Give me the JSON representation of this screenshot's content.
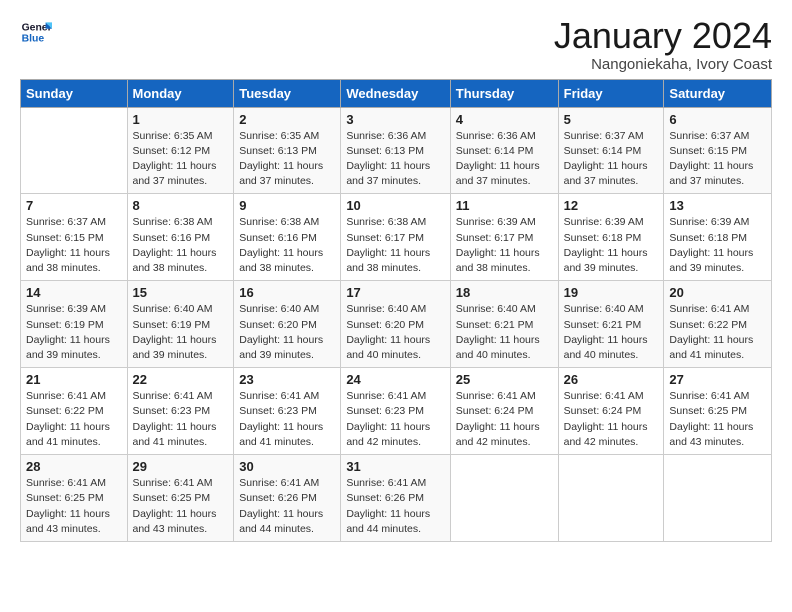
{
  "logo": {
    "line1": "General",
    "line2": "Blue"
  },
  "title": "January 2024",
  "subtitle": "Nangoniekaha, Ivory Coast",
  "days_header": [
    "Sunday",
    "Monday",
    "Tuesday",
    "Wednesday",
    "Thursday",
    "Friday",
    "Saturday"
  ],
  "weeks": [
    [
      {
        "day": "",
        "info": ""
      },
      {
        "day": "1",
        "info": "Sunrise: 6:35 AM\nSunset: 6:12 PM\nDaylight: 11 hours\nand 37 minutes."
      },
      {
        "day": "2",
        "info": "Sunrise: 6:35 AM\nSunset: 6:13 PM\nDaylight: 11 hours\nand 37 minutes."
      },
      {
        "day": "3",
        "info": "Sunrise: 6:36 AM\nSunset: 6:13 PM\nDaylight: 11 hours\nand 37 minutes."
      },
      {
        "day": "4",
        "info": "Sunrise: 6:36 AM\nSunset: 6:14 PM\nDaylight: 11 hours\nand 37 minutes."
      },
      {
        "day": "5",
        "info": "Sunrise: 6:37 AM\nSunset: 6:14 PM\nDaylight: 11 hours\nand 37 minutes."
      },
      {
        "day": "6",
        "info": "Sunrise: 6:37 AM\nSunset: 6:15 PM\nDaylight: 11 hours\nand 37 minutes."
      }
    ],
    [
      {
        "day": "7",
        "info": "Sunrise: 6:37 AM\nSunset: 6:15 PM\nDaylight: 11 hours\nand 38 minutes."
      },
      {
        "day": "8",
        "info": "Sunrise: 6:38 AM\nSunset: 6:16 PM\nDaylight: 11 hours\nand 38 minutes."
      },
      {
        "day": "9",
        "info": "Sunrise: 6:38 AM\nSunset: 6:16 PM\nDaylight: 11 hours\nand 38 minutes."
      },
      {
        "day": "10",
        "info": "Sunrise: 6:38 AM\nSunset: 6:17 PM\nDaylight: 11 hours\nand 38 minutes."
      },
      {
        "day": "11",
        "info": "Sunrise: 6:39 AM\nSunset: 6:17 PM\nDaylight: 11 hours\nand 38 minutes."
      },
      {
        "day": "12",
        "info": "Sunrise: 6:39 AM\nSunset: 6:18 PM\nDaylight: 11 hours\nand 39 minutes."
      },
      {
        "day": "13",
        "info": "Sunrise: 6:39 AM\nSunset: 6:18 PM\nDaylight: 11 hours\nand 39 minutes."
      }
    ],
    [
      {
        "day": "14",
        "info": "Sunrise: 6:39 AM\nSunset: 6:19 PM\nDaylight: 11 hours\nand 39 minutes."
      },
      {
        "day": "15",
        "info": "Sunrise: 6:40 AM\nSunset: 6:19 PM\nDaylight: 11 hours\nand 39 minutes."
      },
      {
        "day": "16",
        "info": "Sunrise: 6:40 AM\nSunset: 6:20 PM\nDaylight: 11 hours\nand 39 minutes."
      },
      {
        "day": "17",
        "info": "Sunrise: 6:40 AM\nSunset: 6:20 PM\nDaylight: 11 hours\nand 40 minutes."
      },
      {
        "day": "18",
        "info": "Sunrise: 6:40 AM\nSunset: 6:21 PM\nDaylight: 11 hours\nand 40 minutes."
      },
      {
        "day": "19",
        "info": "Sunrise: 6:40 AM\nSunset: 6:21 PM\nDaylight: 11 hours\nand 40 minutes."
      },
      {
        "day": "20",
        "info": "Sunrise: 6:41 AM\nSunset: 6:22 PM\nDaylight: 11 hours\nand 41 minutes."
      }
    ],
    [
      {
        "day": "21",
        "info": "Sunrise: 6:41 AM\nSunset: 6:22 PM\nDaylight: 11 hours\nand 41 minutes."
      },
      {
        "day": "22",
        "info": "Sunrise: 6:41 AM\nSunset: 6:23 PM\nDaylight: 11 hours\nand 41 minutes."
      },
      {
        "day": "23",
        "info": "Sunrise: 6:41 AM\nSunset: 6:23 PM\nDaylight: 11 hours\nand 41 minutes."
      },
      {
        "day": "24",
        "info": "Sunrise: 6:41 AM\nSunset: 6:23 PM\nDaylight: 11 hours\nand 42 minutes."
      },
      {
        "day": "25",
        "info": "Sunrise: 6:41 AM\nSunset: 6:24 PM\nDaylight: 11 hours\nand 42 minutes."
      },
      {
        "day": "26",
        "info": "Sunrise: 6:41 AM\nSunset: 6:24 PM\nDaylight: 11 hours\nand 42 minutes."
      },
      {
        "day": "27",
        "info": "Sunrise: 6:41 AM\nSunset: 6:25 PM\nDaylight: 11 hours\nand 43 minutes."
      }
    ],
    [
      {
        "day": "28",
        "info": "Sunrise: 6:41 AM\nSunset: 6:25 PM\nDaylight: 11 hours\nand 43 minutes."
      },
      {
        "day": "29",
        "info": "Sunrise: 6:41 AM\nSunset: 6:25 PM\nDaylight: 11 hours\nand 43 minutes."
      },
      {
        "day": "30",
        "info": "Sunrise: 6:41 AM\nSunset: 6:26 PM\nDaylight: 11 hours\nand 44 minutes."
      },
      {
        "day": "31",
        "info": "Sunrise: 6:41 AM\nSunset: 6:26 PM\nDaylight: 11 hours\nand 44 minutes."
      },
      {
        "day": "",
        "info": ""
      },
      {
        "day": "",
        "info": ""
      },
      {
        "day": "",
        "info": ""
      }
    ]
  ]
}
